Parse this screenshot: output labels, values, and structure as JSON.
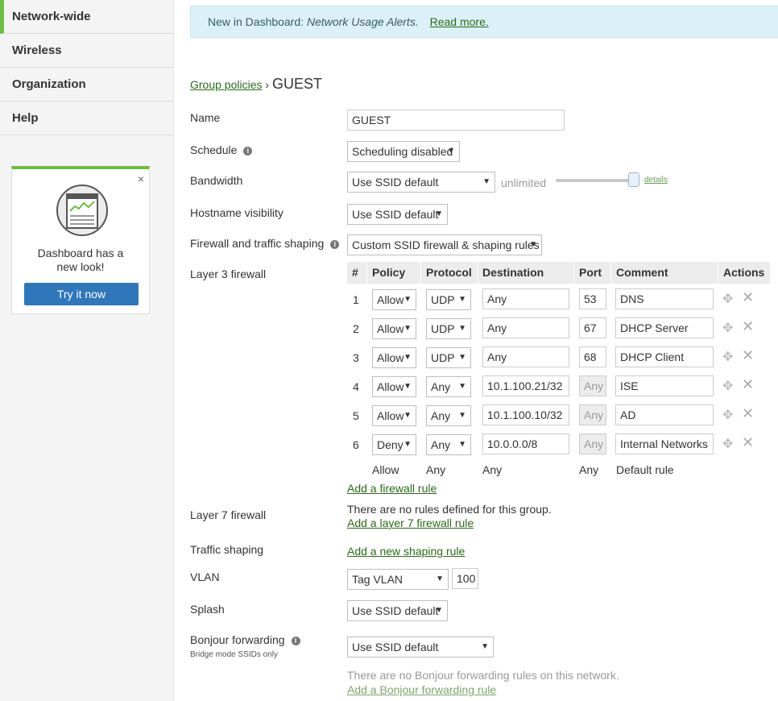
{
  "sidebar": {
    "items": [
      {
        "label": "Network-wide",
        "active": true
      },
      {
        "label": "Wireless"
      },
      {
        "label": "Organization"
      },
      {
        "label": "Help"
      }
    ],
    "promo": {
      "text_line1": "Dashboard has a",
      "text_line2": "new look!",
      "button": "Try it now",
      "close": "×"
    }
  },
  "banner": {
    "prefix": "New in Dashboard:",
    "feature": "Network Usage Alerts.",
    "link": "Read more."
  },
  "breadcrumb": {
    "parent": "Group policies",
    "separator": "›",
    "current": "GUEST"
  },
  "form": {
    "name_label": "Name",
    "name_value": "GUEST",
    "schedule_label": "Schedule",
    "schedule_value": "Scheduling disabled",
    "bandwidth_label": "Bandwidth",
    "bandwidth_value": "Use SSID default",
    "bandwidth_limit": "unlimited",
    "bandwidth_details": "details",
    "hostname_label": "Hostname visibility",
    "hostname_value": "Use SSID default",
    "firewall_label": "Firewall and traffic shaping",
    "firewall_value": "Custom SSID firewall & shaping rules",
    "l3_label": "Layer 3 firewall",
    "l7_label": "Layer 7 firewall",
    "l7_empty": "There are no rules defined for this group.",
    "l7_add": "Add a layer 7 firewall rule",
    "shaping_label": "Traffic shaping",
    "shaping_add": "Add a new shaping rule",
    "vlan_label": "VLAN",
    "vlan_value": "Tag VLAN",
    "vlan_id": "100",
    "splash_label": "Splash",
    "splash_value": "Use SSID default",
    "bonjour_label": "Bonjour forwarding",
    "bonjour_sub": "Bridge mode SSIDs only",
    "bonjour_value": "Use SSID default",
    "bonjour_empty": "There are no Bonjour forwarding rules on this network.",
    "bonjour_add": "Add a Bonjour forwarding rule"
  },
  "l3_table": {
    "headers": [
      "#",
      "Policy",
      "Protocol",
      "Destination",
      "Port",
      "Comment",
      "Actions"
    ],
    "rows": [
      {
        "num": "1",
        "policy": "Allow",
        "protocol": "UDP",
        "destination": "Any",
        "port": "53",
        "comment": "DNS"
      },
      {
        "num": "2",
        "policy": "Allow",
        "protocol": "UDP",
        "destination": "Any",
        "port": "67",
        "comment": "DHCP Server"
      },
      {
        "num": "3",
        "policy": "Allow",
        "protocol": "UDP",
        "destination": "Any",
        "port": "68",
        "comment": "DHCP Client"
      },
      {
        "num": "4",
        "policy": "Allow",
        "protocol": "Any",
        "destination": "10.1.100.21/32",
        "port": "Any",
        "comment": "ISE"
      },
      {
        "num": "5",
        "policy": "Allow",
        "protocol": "Any",
        "destination": "10.1.100.10/32",
        "port": "Any",
        "comment": "AD"
      },
      {
        "num": "6",
        "policy": "Deny",
        "protocol": "Any",
        "destination": "10.0.0.0/8",
        "port": "Any",
        "comment": "Internal Networks"
      }
    ],
    "default_rule": {
      "policy": "Allow",
      "protocol": "Any",
      "destination": "Any",
      "port": "Any",
      "comment": "Default rule"
    },
    "add_link": "Add a firewall rule"
  },
  "info_icon": "i",
  "colors": {
    "accent": "#6bbe3e",
    "link": "#2a6b17",
    "button": "#2f77bb",
    "banner_bg": "#dcf1f7"
  }
}
